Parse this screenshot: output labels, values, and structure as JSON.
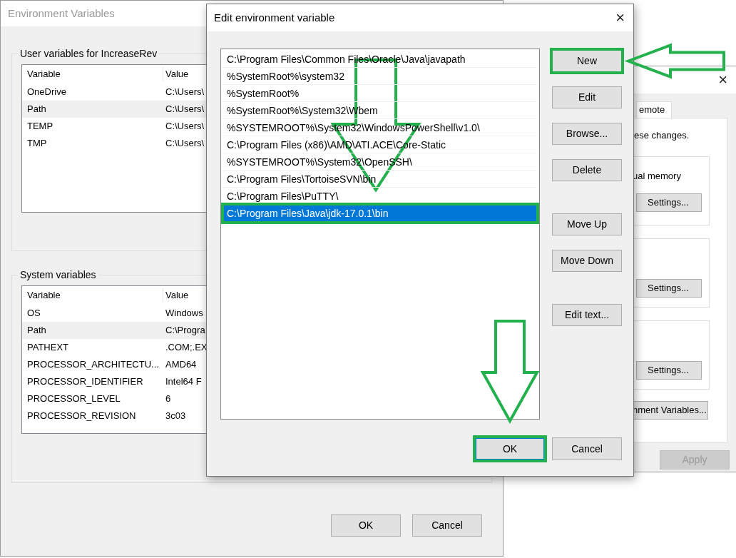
{
  "env_window": {
    "title": "Environment Variables",
    "user_variables": {
      "title": "User variables for IncreaseRev",
      "columns": [
        "Variable",
        "Value"
      ],
      "rows": [
        {
          "variable": "OneDrive",
          "value": "C:\\Users\\",
          "selected": false
        },
        {
          "variable": "Path",
          "value": "C:\\Users\\",
          "selected": true
        },
        {
          "variable": "TEMP",
          "value": "C:\\Users\\",
          "selected": false
        },
        {
          "variable": "TMP",
          "value": "C:\\Users\\",
          "selected": false
        }
      ]
    },
    "system_variables": {
      "title": "System variables",
      "columns": [
        "Variable",
        "Value"
      ],
      "rows": [
        {
          "variable": "OS",
          "value": "Windows",
          "selected": false
        },
        {
          "variable": "Path",
          "value": "C:\\Progra",
          "selected": true
        },
        {
          "variable": "PATHEXT",
          "value": ".COM;.EX",
          "selected": false
        },
        {
          "variable": "PROCESSOR_ARCHITECTU...",
          "value": "AMD64",
          "selected": false
        },
        {
          "variable": "PROCESSOR_IDENTIFIER",
          "value": "Intel64 F",
          "selected": false
        },
        {
          "variable": "PROCESSOR_LEVEL",
          "value": "6",
          "selected": false
        },
        {
          "variable": "PROCESSOR_REVISION",
          "value": "3c03",
          "selected": false
        }
      ]
    },
    "buttons": [
      "OK",
      "Cancel"
    ]
  },
  "system_properties": {
    "close": "×",
    "tab": "emote",
    "note": "ese changes.",
    "groups": [
      {
        "text": "ual memory",
        "button": "Settings..."
      },
      {
        "button": "Settings..."
      },
      {
        "button": "Settings..."
      }
    ],
    "env_button": "nment Variables...",
    "apply": {
      "label": "Apply",
      "disabled": true
    }
  },
  "edit_dialog": {
    "title": "Edit environment variable",
    "close": "×",
    "entries": [
      {
        "text": "C:\\Program Files\\Common Files\\Oracle\\Java\\javapath",
        "selected": false,
        "highlighted": false
      },
      {
        "text": "%SystemRoot%\\system32",
        "selected": false,
        "highlighted": false
      },
      {
        "text": "%SystemRoot%",
        "selected": false,
        "highlighted": false
      },
      {
        "text": "%SystemRoot%\\System32\\Wbem",
        "selected": false,
        "highlighted": false
      },
      {
        "text": "%SYSTEMROOT%\\System32\\WindowsPowerShell\\v1.0\\",
        "selected": false,
        "highlighted": false
      },
      {
        "text": "C:\\Program Files (x86)\\AMD\\ATI.ACE\\Core-Static",
        "selected": false,
        "highlighted": false
      },
      {
        "text": "%SYSTEMROOT%\\System32\\OpenSSH\\",
        "selected": false,
        "highlighted": false
      },
      {
        "text": "C:\\Program Files\\TortoiseSVN\\bin",
        "selected": false,
        "highlighted": false
      },
      {
        "text": "C:\\Program Files\\PuTTY\\",
        "selected": false,
        "highlighted": false
      },
      {
        "text": "C:\\Program Files\\Java\\jdk-17.0.1\\bin",
        "selected": true,
        "highlighted": true
      }
    ],
    "side_buttons": [
      {
        "label": "New",
        "highlighted": true
      },
      {
        "label": "Edit",
        "highlighted": false
      },
      {
        "label": "Browse...",
        "highlighted": false
      },
      {
        "label": "Delete",
        "highlighted": false
      },
      {
        "label": "Move Up",
        "highlighted": false
      },
      {
        "label": "Move Down",
        "highlighted": false
      },
      {
        "label": "Edit text...",
        "highlighted": false
      }
    ],
    "buttons": [
      {
        "label": "OK",
        "default": true,
        "highlighted": true
      },
      {
        "label": "Cancel",
        "default": false,
        "highlighted": false
      }
    ]
  }
}
